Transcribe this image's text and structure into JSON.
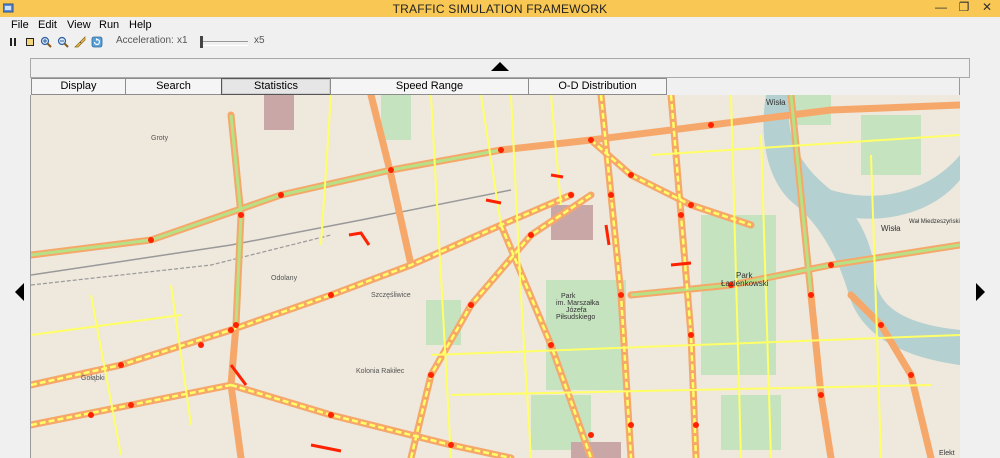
{
  "window": {
    "title": "TRAFFIC SIMULATION FRAMEWORK",
    "minimize_glyph": "—",
    "restore_glyph": "❐",
    "close_glyph": "✕"
  },
  "menu": {
    "items": [
      "File",
      "Edit",
      "View",
      "Run",
      "Help"
    ]
  },
  "toolbar": {
    "icons": [
      "pause-icon",
      "stop-icon",
      "zoom-in-icon",
      "zoom-out-icon",
      "ruler-icon",
      "refresh-icon"
    ],
    "acceleration_label": "Acceleration:",
    "min_label": "x1",
    "max_label": "x5",
    "acceleration_value": 1
  },
  "tabs": [
    {
      "label": "Display",
      "active": false
    },
    {
      "label": "Search",
      "active": false
    },
    {
      "label": "Statistics",
      "active": true
    },
    {
      "label": "Speed Range",
      "active": false
    },
    {
      "label": "O-D Distribution",
      "active": false
    }
  ],
  "map": {
    "labels": {
      "grody": "Groty",
      "odolany": "Odolany",
      "szczesliwice": "Szczęśliwice",
      "kolonia": "Kolonia Rakiłec",
      "golabki": "Gołąbki",
      "park_marszal": "Park",
      "park_marszal2": "im. Marszałka",
      "park_marszal3": "Józefa",
      "park_marszal4": "Piłsudskiego",
      "park_laz": "Park",
      "park_laz2": "Łazienkowski",
      "wisla_top": "Wisła",
      "wisla_right": "Wisła",
      "wal_miedz": "Wał Miedzeszyński",
      "elekt": "Elekt"
    },
    "colors": {
      "land": "#eee8dd",
      "park": "#c5e3bf",
      "river": "#b5d0d0",
      "major_road": "#f6a86a",
      "congestion_green": "#b8e186",
      "congestion_yellow": "#ffff66",
      "congestion_red": "#ff2200"
    }
  }
}
